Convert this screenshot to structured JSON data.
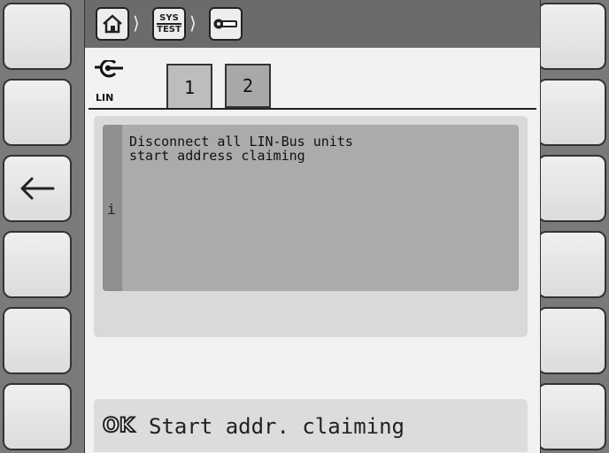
{
  "breadcrumb": {
    "items": [
      {
        "icon": "home-icon"
      },
      {
        "icon": "sys-test-icon",
        "line1": "SYS",
        "line2": "TEST"
      },
      {
        "icon": "key-icon"
      }
    ],
    "separator": "⟩"
  },
  "section": {
    "icon": "lin-bus-icon",
    "label": "LIN"
  },
  "tabs": [
    {
      "label": "1",
      "active": true
    },
    {
      "label": "2",
      "active": false
    }
  ],
  "message": {
    "icon": "info-icon",
    "icon_text": "i",
    "lines": [
      "Disconnect all LIN-Bus units",
      "start address claiming"
    ]
  },
  "action": {
    "icon": "ok-icon",
    "icon_text": "OK",
    "label": "Start addr. claiming"
  },
  "softkeys": {
    "left": [
      "",
      "",
      "back-arrow-icon",
      "",
      "",
      ""
    ],
    "right": [
      "",
      "",
      "",
      "",
      "",
      ""
    ]
  }
}
